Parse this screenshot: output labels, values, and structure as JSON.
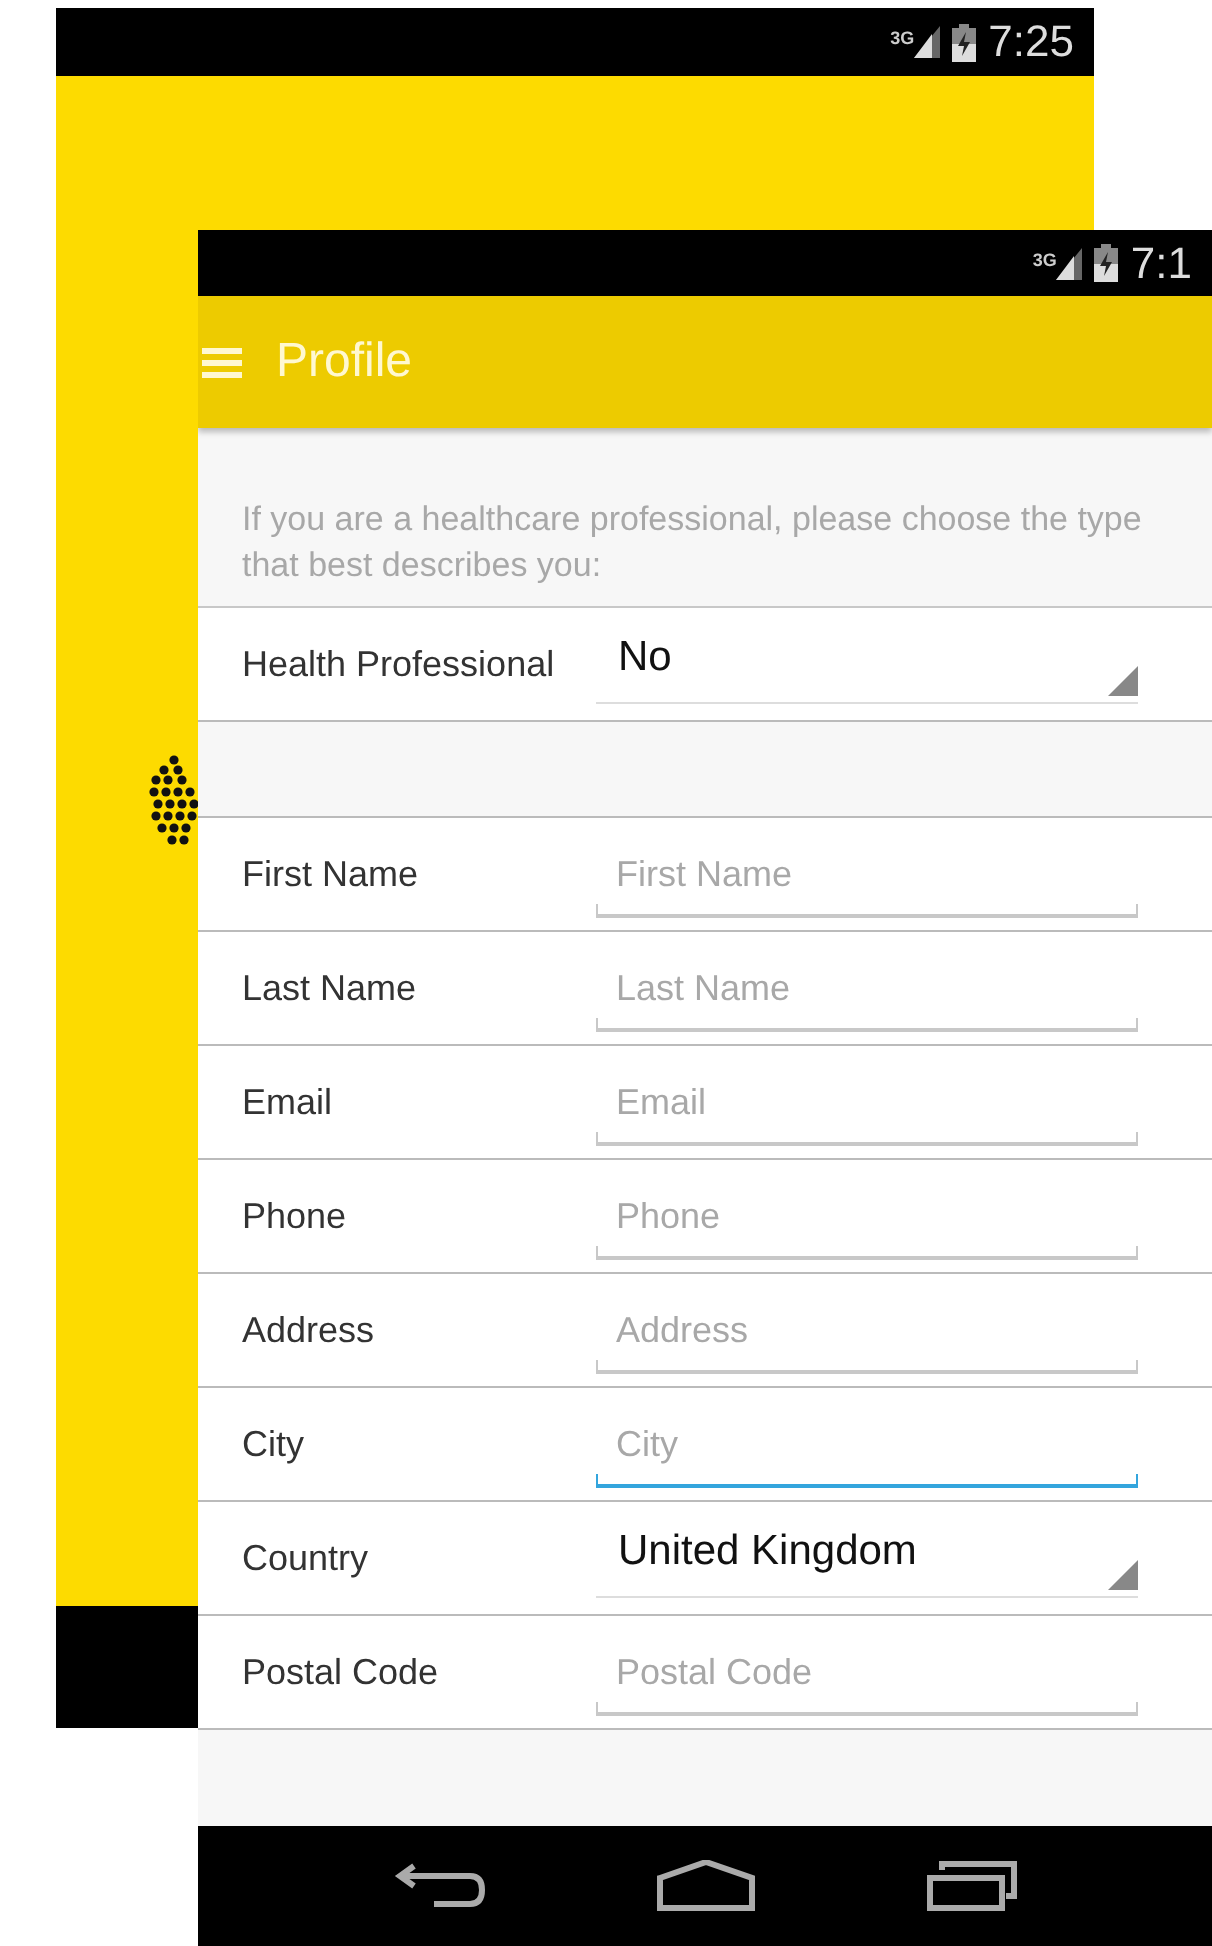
{
  "back_screen": {
    "status_bar": {
      "network": "3G",
      "time": "7:25"
    }
  },
  "front_screen": {
    "status_bar": {
      "network": "3G",
      "time": "7:1"
    },
    "app_bar": {
      "title": "Profile"
    },
    "intro": "If you are a healthcare professional, please choose the type that best describes you:",
    "professional_row": {
      "label": "Health Professional",
      "kind": "dropdown",
      "value": "No"
    },
    "fields": [
      {
        "label": "First Name",
        "kind": "text",
        "placeholder": "First Name",
        "focused": false
      },
      {
        "label": "Last Name",
        "kind": "text",
        "placeholder": "Last Name",
        "focused": false
      },
      {
        "label": "Email",
        "kind": "text",
        "placeholder": "Email",
        "focused": false
      },
      {
        "label": "Phone",
        "kind": "text",
        "placeholder": "Phone",
        "focused": false
      },
      {
        "label": "Address",
        "kind": "text",
        "placeholder": "Address",
        "focused": false
      },
      {
        "label": "City",
        "kind": "text",
        "placeholder": "City",
        "focused": true
      },
      {
        "label": "Country",
        "kind": "dropdown",
        "value": "United Kingdom"
      },
      {
        "label": "Postal Code",
        "kind": "text",
        "placeholder": "Postal Code",
        "focused": false
      }
    ]
  }
}
